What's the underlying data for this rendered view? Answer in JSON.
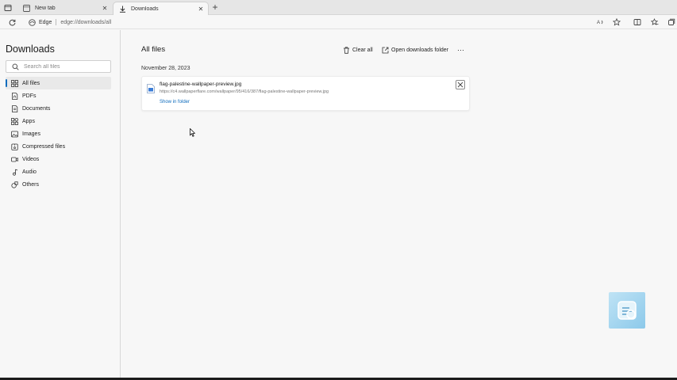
{
  "tabs": [
    {
      "title": "New tab",
      "icon": "page-icon",
      "active": false
    },
    {
      "title": "Downloads",
      "icon": "download-icon",
      "active": true
    }
  ],
  "toolbar": {
    "brand": "Edge",
    "url": "edge://downloads/all"
  },
  "sidebar": {
    "title": "Downloads",
    "search_placeholder": "Search all files",
    "items": [
      {
        "label": "All files",
        "icon": "grid-icon",
        "selected": true
      },
      {
        "label": "PDFs",
        "icon": "pdf-icon",
        "selected": false
      },
      {
        "label": "Documents",
        "icon": "document-icon",
        "selected": false
      },
      {
        "label": "Apps",
        "icon": "apps-icon",
        "selected": false
      },
      {
        "label": "Images",
        "icon": "image-icon",
        "selected": false
      },
      {
        "label": "Compressed files",
        "icon": "archive-icon",
        "selected": false
      },
      {
        "label": "Videos",
        "icon": "video-icon",
        "selected": false
      },
      {
        "label": "Audio",
        "icon": "music-icon",
        "selected": false
      },
      {
        "label": "Others",
        "icon": "other-icon",
        "selected": false
      }
    ]
  },
  "main": {
    "title": "All files",
    "clear_all": "Clear all",
    "open_folder": "Open downloads folder",
    "more": "···",
    "date": "November 28, 2023",
    "file": {
      "name": "flag-palestine-wallpaper-preview.jpg",
      "url": "https://c4.wallpaperflare.com/wallpaper/95/416/387/flag-palestine-wallpaper-preview.jpg",
      "link": "Show in folder"
    }
  },
  "colors": {
    "accent": "#0f6cbd"
  }
}
